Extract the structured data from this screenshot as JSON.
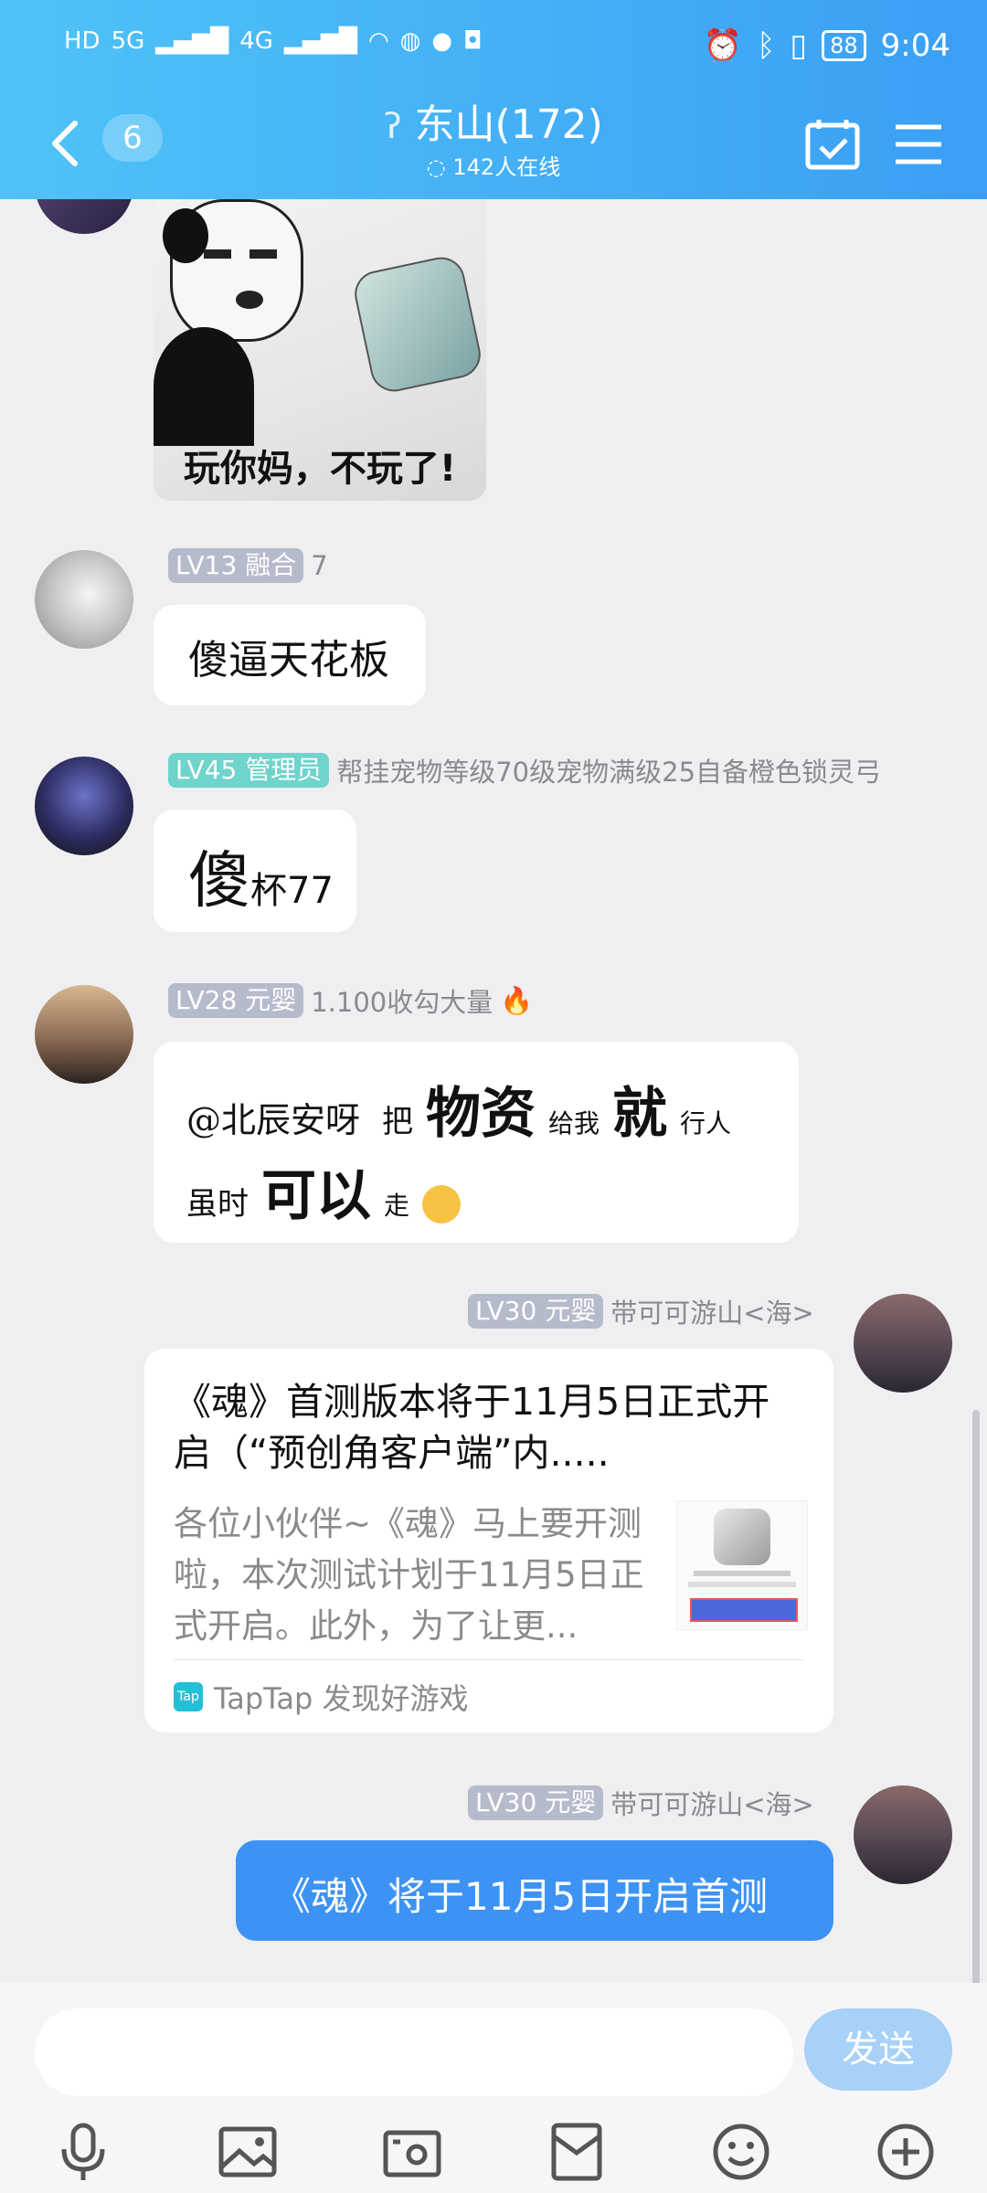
{
  "status_bar": {
    "left": [
      "HD",
      "5G",
      "4G"
    ],
    "battery": "88",
    "time": "9:04"
  },
  "header": {
    "unread_count": "6",
    "group_name": "东山(172)",
    "online_count": "142人在线"
  },
  "messages": [
    {
      "type": "image",
      "caption": "玩你妈，不玩了!"
    },
    {
      "type": "text",
      "level": "LV13",
      "title": "融合",
      "nickname": "7",
      "text": "傻逼天花板"
    },
    {
      "type": "text",
      "level": "LV45",
      "title": "管理员",
      "nickname": "帮挂宠物等级70级宠物满级25自备橙色锁灵弓",
      "text_big": "傻",
      "text_small": "杯77"
    },
    {
      "type": "text",
      "level": "LV28",
      "title": "元婴",
      "nickname": "1.100收勾大量",
      "line1": [
        "@北辰安呀",
        "把",
        "物资",
        "给我",
        "就",
        "行人"
      ],
      "line2": [
        "虽时",
        "可以",
        "走"
      ]
    },
    {
      "type": "card",
      "level": "LV30",
      "title": "元婴",
      "nickname": "带可可游山<海>",
      "card_title": "《魂》首测版本将于11月5日正式开启（“预创角客户端”内.....",
      "card_desc": "各位小伙伴~《魂》马上要开测啦，本次测试计划于11月5日正式开启。此外，为了让更...",
      "source": "TapTap 发现好游戏",
      "source_icon": "Tap"
    },
    {
      "type": "sent",
      "level": "LV30",
      "title": "元婴",
      "nickname": "带可可游山<海>",
      "text": "《魂》将于11月5日开启首测"
    }
  ],
  "input": {
    "send_label": "发送"
  }
}
